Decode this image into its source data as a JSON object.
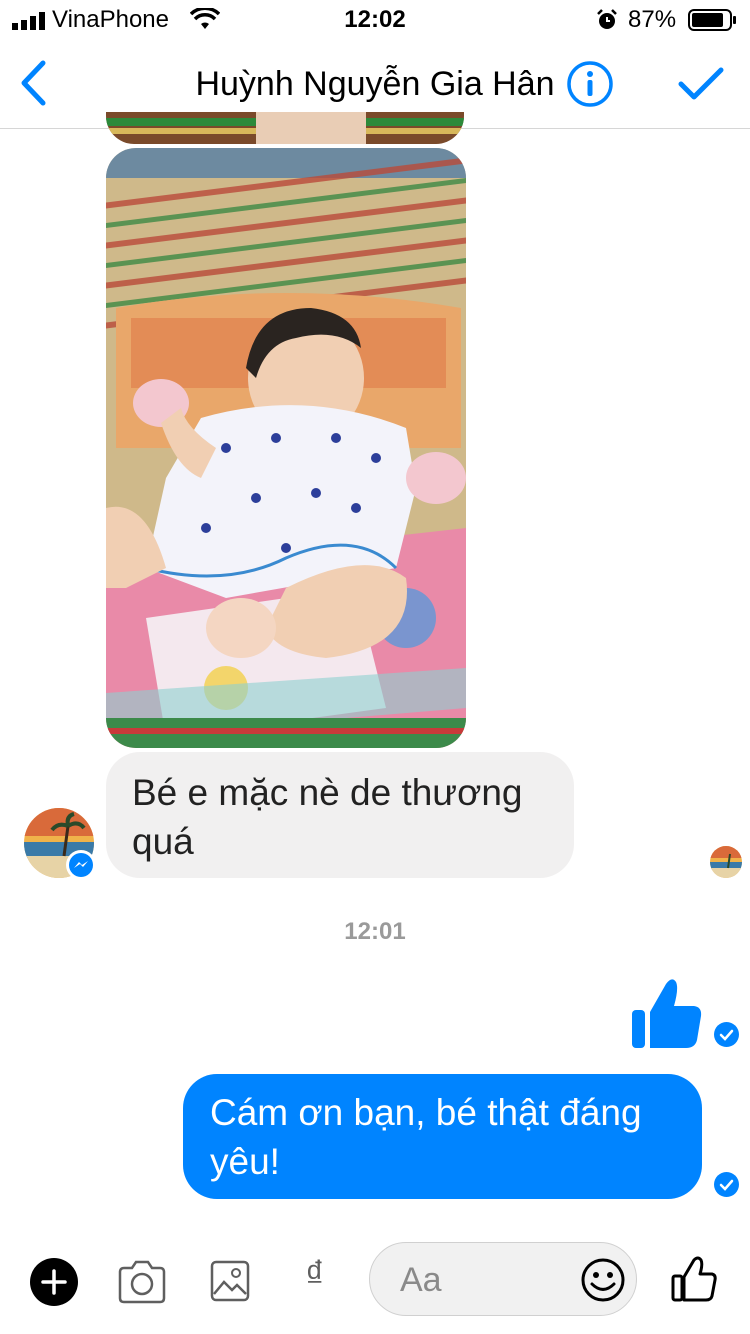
{
  "status_bar": {
    "carrier": "VinaPhone",
    "time": "12:02",
    "battery_percent": "87%",
    "battery_level": 0.87
  },
  "header": {
    "title": "Huỳnh Nguyễn Gia Hân",
    "back_icon": "chevron-left-icon",
    "info_icon": "info-icon",
    "done_icon": "checkmark-icon",
    "accent_color": "#0084ff"
  },
  "thread": {
    "incoming_text": "Bé e mặc nè de thương quá",
    "timestamp": "12:01",
    "outgoing_text": "Cám ơn bạn, bé thật đáng yêu!",
    "incoming_bubble_color": "#f1f0f0",
    "outgoing_bubble_color": "#0084ff"
  },
  "composer": {
    "placeholder": "Aa",
    "dong_symbol": "₫",
    "icons": [
      "plus-icon",
      "camera-icon",
      "gallery-icon",
      "dong-icon",
      "emoji-icon",
      "thumbs-up-icon"
    ]
  }
}
